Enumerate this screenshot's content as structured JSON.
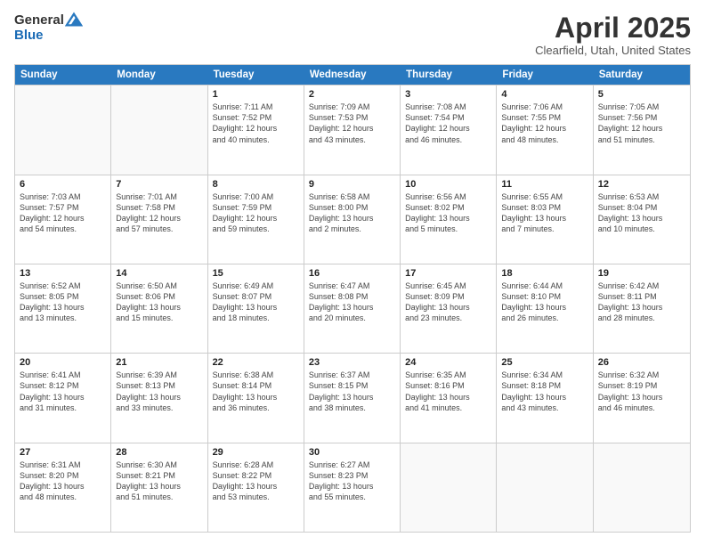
{
  "header": {
    "logo": {
      "general": "General",
      "blue": "Blue"
    },
    "title": "April 2025",
    "location": "Clearfield, Utah, United States"
  },
  "calendar": {
    "days_of_week": [
      "Sunday",
      "Monday",
      "Tuesday",
      "Wednesday",
      "Thursday",
      "Friday",
      "Saturday"
    ],
    "weeks": [
      [
        {
          "day": "",
          "info": ""
        },
        {
          "day": "",
          "info": ""
        },
        {
          "day": "1",
          "info": "Sunrise: 7:11 AM\nSunset: 7:52 PM\nDaylight: 12 hours\nand 40 minutes."
        },
        {
          "day": "2",
          "info": "Sunrise: 7:09 AM\nSunset: 7:53 PM\nDaylight: 12 hours\nand 43 minutes."
        },
        {
          "day": "3",
          "info": "Sunrise: 7:08 AM\nSunset: 7:54 PM\nDaylight: 12 hours\nand 46 minutes."
        },
        {
          "day": "4",
          "info": "Sunrise: 7:06 AM\nSunset: 7:55 PM\nDaylight: 12 hours\nand 48 minutes."
        },
        {
          "day": "5",
          "info": "Sunrise: 7:05 AM\nSunset: 7:56 PM\nDaylight: 12 hours\nand 51 minutes."
        }
      ],
      [
        {
          "day": "6",
          "info": "Sunrise: 7:03 AM\nSunset: 7:57 PM\nDaylight: 12 hours\nand 54 minutes."
        },
        {
          "day": "7",
          "info": "Sunrise: 7:01 AM\nSunset: 7:58 PM\nDaylight: 12 hours\nand 57 minutes."
        },
        {
          "day": "8",
          "info": "Sunrise: 7:00 AM\nSunset: 7:59 PM\nDaylight: 12 hours\nand 59 minutes."
        },
        {
          "day": "9",
          "info": "Sunrise: 6:58 AM\nSunset: 8:00 PM\nDaylight: 13 hours\nand 2 minutes."
        },
        {
          "day": "10",
          "info": "Sunrise: 6:56 AM\nSunset: 8:02 PM\nDaylight: 13 hours\nand 5 minutes."
        },
        {
          "day": "11",
          "info": "Sunrise: 6:55 AM\nSunset: 8:03 PM\nDaylight: 13 hours\nand 7 minutes."
        },
        {
          "day": "12",
          "info": "Sunrise: 6:53 AM\nSunset: 8:04 PM\nDaylight: 13 hours\nand 10 minutes."
        }
      ],
      [
        {
          "day": "13",
          "info": "Sunrise: 6:52 AM\nSunset: 8:05 PM\nDaylight: 13 hours\nand 13 minutes."
        },
        {
          "day": "14",
          "info": "Sunrise: 6:50 AM\nSunset: 8:06 PM\nDaylight: 13 hours\nand 15 minutes."
        },
        {
          "day": "15",
          "info": "Sunrise: 6:49 AM\nSunset: 8:07 PM\nDaylight: 13 hours\nand 18 minutes."
        },
        {
          "day": "16",
          "info": "Sunrise: 6:47 AM\nSunset: 8:08 PM\nDaylight: 13 hours\nand 20 minutes."
        },
        {
          "day": "17",
          "info": "Sunrise: 6:45 AM\nSunset: 8:09 PM\nDaylight: 13 hours\nand 23 minutes."
        },
        {
          "day": "18",
          "info": "Sunrise: 6:44 AM\nSunset: 8:10 PM\nDaylight: 13 hours\nand 26 minutes."
        },
        {
          "day": "19",
          "info": "Sunrise: 6:42 AM\nSunset: 8:11 PM\nDaylight: 13 hours\nand 28 minutes."
        }
      ],
      [
        {
          "day": "20",
          "info": "Sunrise: 6:41 AM\nSunset: 8:12 PM\nDaylight: 13 hours\nand 31 minutes."
        },
        {
          "day": "21",
          "info": "Sunrise: 6:39 AM\nSunset: 8:13 PM\nDaylight: 13 hours\nand 33 minutes."
        },
        {
          "day": "22",
          "info": "Sunrise: 6:38 AM\nSunset: 8:14 PM\nDaylight: 13 hours\nand 36 minutes."
        },
        {
          "day": "23",
          "info": "Sunrise: 6:37 AM\nSunset: 8:15 PM\nDaylight: 13 hours\nand 38 minutes."
        },
        {
          "day": "24",
          "info": "Sunrise: 6:35 AM\nSunset: 8:16 PM\nDaylight: 13 hours\nand 41 minutes."
        },
        {
          "day": "25",
          "info": "Sunrise: 6:34 AM\nSunset: 8:18 PM\nDaylight: 13 hours\nand 43 minutes."
        },
        {
          "day": "26",
          "info": "Sunrise: 6:32 AM\nSunset: 8:19 PM\nDaylight: 13 hours\nand 46 minutes."
        }
      ],
      [
        {
          "day": "27",
          "info": "Sunrise: 6:31 AM\nSunset: 8:20 PM\nDaylight: 13 hours\nand 48 minutes."
        },
        {
          "day": "28",
          "info": "Sunrise: 6:30 AM\nSunset: 8:21 PM\nDaylight: 13 hours\nand 51 minutes."
        },
        {
          "day": "29",
          "info": "Sunrise: 6:28 AM\nSunset: 8:22 PM\nDaylight: 13 hours\nand 53 minutes."
        },
        {
          "day": "30",
          "info": "Sunrise: 6:27 AM\nSunset: 8:23 PM\nDaylight: 13 hours\nand 55 minutes."
        },
        {
          "day": "",
          "info": ""
        },
        {
          "day": "",
          "info": ""
        },
        {
          "day": "",
          "info": ""
        }
      ]
    ]
  }
}
